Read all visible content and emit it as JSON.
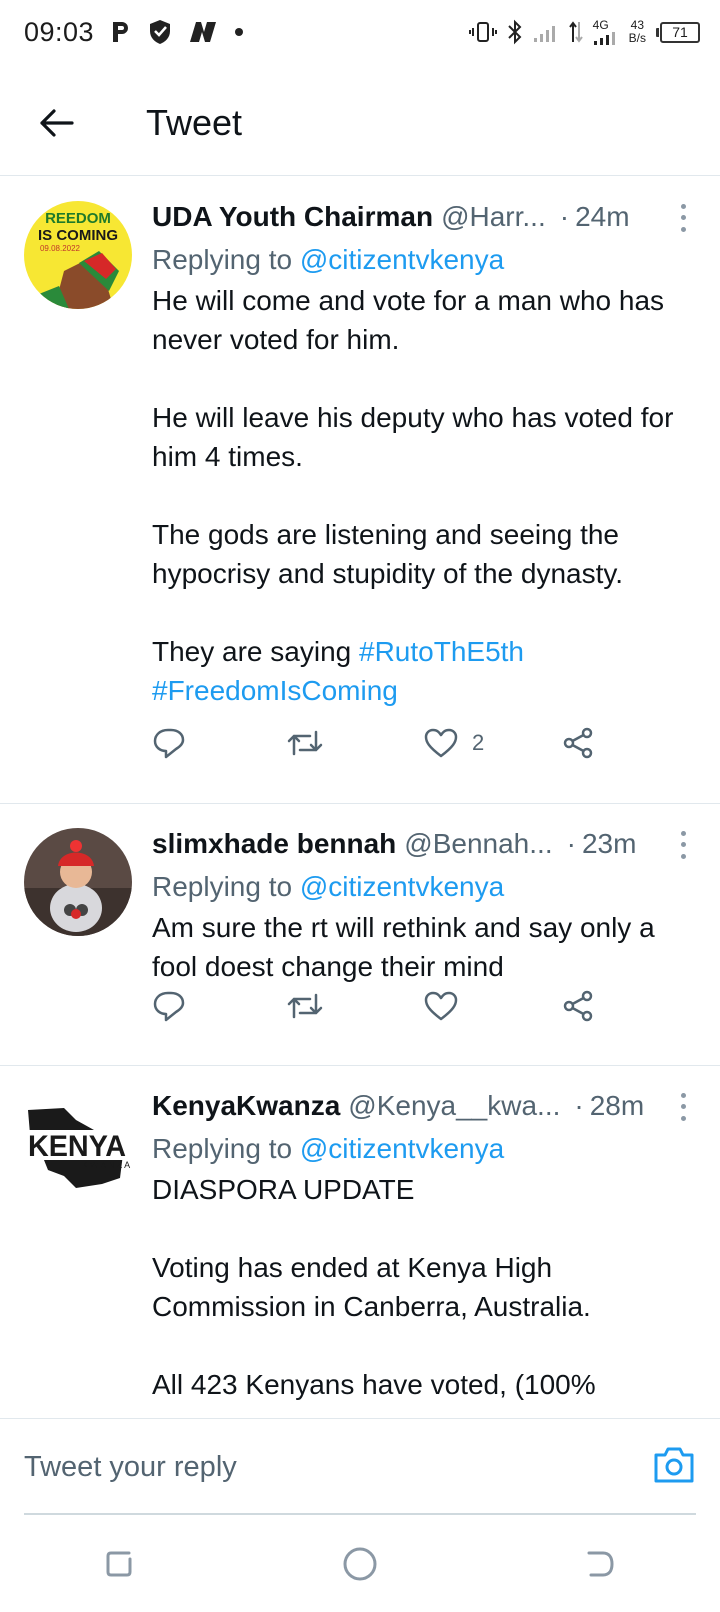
{
  "status_bar": {
    "time": "09:03",
    "network_type": "4G",
    "net_speed_value": "43",
    "net_speed_unit": "B/s",
    "battery": "71"
  },
  "header": {
    "title": "Tweet"
  },
  "tweets": [
    {
      "name": "UDA Youth Chairman",
      "handle": "@Harr...",
      "dot": "·",
      "time": "24m",
      "replying_prefix": "Replying to ",
      "replying_to": "@citizentvkenya",
      "text_main": "He will come and vote for a man who has never voted for him.\n\nHe will leave his deputy who has voted for him 4 times.\n\nThe gods are listening and seeing the hypocrisy and stupidity of the dynasty.\n\nThey are saying ",
      "hashtag1": "#RutoThE5th",
      "hashtag2": "#FreedomIsComing",
      "likes": "2",
      "avatar_text_line1": "REEDOM",
      "avatar_text_line2": "IS COMING",
      "avatar_text_line3": "09.08.2022"
    },
    {
      "name": "slimxhade bennah",
      "handle": "@Bennah...",
      "dot": "·",
      "time": "23m",
      "replying_prefix": "Replying to ",
      "replying_to": "@citizentvkenya",
      "text": "Am sure the rt will rethink and say only a fool doest change their mind"
    },
    {
      "name": "KenyaKwanza",
      "handle": "@Kenya__kwa...",
      "dot": "·",
      "time": "28m",
      "replying_prefix": "Replying to ",
      "replying_to": "@citizentvkenya",
      "text": "DIASPORA UPDATE\n\nVoting has ended at Kenya High Commission in Canberra, Australia.\n\nAll 423 Kenyans have voted, (100%",
      "avatar_logo_main": "KENYA",
      "avatar_logo_sub": "KWANZA"
    }
  ],
  "reply_bar": {
    "placeholder": "Tweet your reply"
  },
  "colors": {
    "link": "#1d9bf0",
    "muted": "#536471",
    "divider": "#e1e8ed"
  }
}
